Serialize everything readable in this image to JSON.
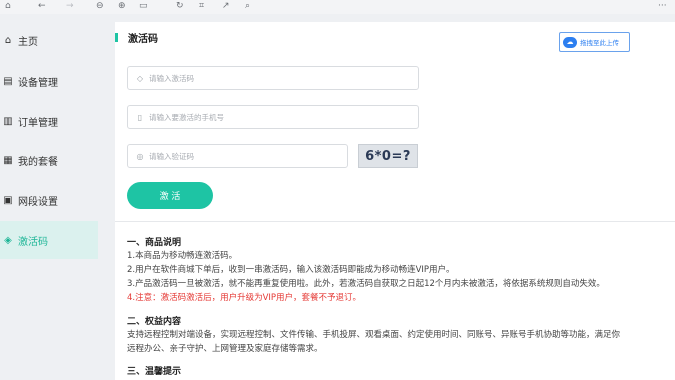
{
  "toolbar": {
    "icons": [
      "home",
      "back",
      "forward",
      "zoom-out",
      "zoom-in",
      "fit",
      "rotate",
      "crop",
      "share",
      "search"
    ],
    "glyphs": {
      "home": "⌂",
      "back": "←",
      "forward": "→",
      "zoom_out": "⊖",
      "zoom_in": "⊕",
      "fit": "▭",
      "rotate": "↻",
      "crop": "⌗",
      "share": "↗",
      "search": "⌕",
      "more": "···"
    }
  },
  "sidebar": {
    "items": [
      {
        "label": "主页",
        "icon": "home-icon",
        "glyph": "⌂"
      },
      {
        "label": "设备管理",
        "icon": "device-icon",
        "glyph": "▤"
      },
      {
        "label": "订单管理",
        "icon": "order-icon",
        "glyph": "▥"
      },
      {
        "label": "我的套餐",
        "icon": "package-icon",
        "glyph": "▦"
      },
      {
        "label": "网段设置",
        "icon": "network-icon",
        "glyph": "▣"
      },
      {
        "label": "激活码",
        "icon": "shield-icon",
        "glyph": "◈"
      }
    ],
    "active_index": 5
  },
  "main": {
    "title": "激活码",
    "upload_button": {
      "label": "拖拽至此上传",
      "icon": "cloud-upload-icon",
      "glyph": "☁"
    },
    "fields": {
      "code": {
        "placeholder": "请输入激活码",
        "value": "",
        "glyph": "◇"
      },
      "phone": {
        "placeholder": "请输入要激活的手机号",
        "value": "",
        "glyph": "▯"
      },
      "captcha": {
        "placeholder": "请输入验证码",
        "value": "",
        "glyph": "◎"
      }
    },
    "captcha_text": "6*0=?",
    "activate_label": "激 活",
    "section1": {
      "heading": "一、商品说明",
      "lines": [
        "1.本商品为移动畅连激活码。",
        "2.用户在软件商城下单后，收到一串激活码，输入该激活码即能成为移动畅连VIP用户。",
        "3.产品激活码一旦被激活，就不能再重复使用啦。此外，若激活码自获取之日起12个月内未被激活，将依据系统规则自动失效。"
      ],
      "warning": "4.注意：激活码激活后，用户升级为VIP用户，套餐不予退订。"
    },
    "section2": {
      "heading": "二、权益内容",
      "lines": [
        "支持远程控制对端设备，实现远程控制、文件传输、手机投屏、观看桌面、约定使用时间、同账号、异账号手机协助等功能，满足你",
        "远程办公、亲子守护、上网管理及家庭存储等需求。"
      ]
    },
    "section3": {
      "heading": "三、温馨提示"
    }
  },
  "colors": {
    "accent": "#1ec4a4",
    "warning": "#e53935",
    "upload_blue": "#2d7ff0",
    "active_bg": "#dbf1ee"
  }
}
